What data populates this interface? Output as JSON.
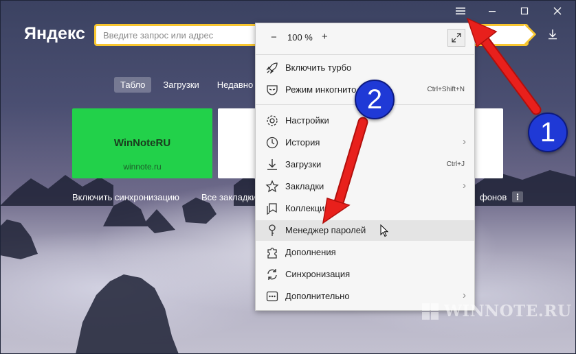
{
  "window": {
    "minimize_icon": "minimize-icon",
    "maximize_icon": "maximize-icon",
    "close_icon": "close-icon"
  },
  "header": {
    "logo": "Яндекс",
    "search_placeholder": "Введите запрос или адрес",
    "search_value": ""
  },
  "tabs": [
    "Табло",
    "Загрузки",
    "Недавно з"
  ],
  "tiles": {
    "tile1_title": "WinNoteRU",
    "tile1_url": "winnote.ru"
  },
  "bottom_links": {
    "sync": "Включить синхронизацию",
    "bookmarks": "Все закладки",
    "backgrounds": "фонов"
  },
  "menu": {
    "zoom_minus": "−",
    "zoom_value": "100 %",
    "zoom_plus": "+",
    "items": [
      {
        "label": "Включить турбо",
        "shortcut": "",
        "arrow": ""
      },
      {
        "label": "Режим инкогнито",
        "shortcut": "Ctrl+Shift+N",
        "arrow": ""
      },
      {
        "label": "Настройки",
        "shortcut": "",
        "arrow": ""
      },
      {
        "label": "История",
        "shortcut": "",
        "arrow": "›"
      },
      {
        "label": "Загрузки",
        "shortcut": "Ctrl+J",
        "arrow": ""
      },
      {
        "label": "Закладки",
        "shortcut": "",
        "arrow": "›"
      },
      {
        "label": "Коллекци",
        "shortcut": "",
        "arrow": ""
      },
      {
        "label": "Менеджер паролей",
        "shortcut": "",
        "arrow": ""
      },
      {
        "label": "Дополнения",
        "shortcut": "",
        "arrow": ""
      },
      {
        "label": "Синхронизация",
        "shortcut": "",
        "arrow": ""
      },
      {
        "label": "Дополнительно",
        "shortcut": "",
        "arrow": "›"
      }
    ]
  },
  "annotations": {
    "badge1": "1",
    "badge2": "2",
    "arrow_color": "#e8201c",
    "badge_color": "#1f39d6"
  },
  "watermark": "WINNOTE.RU"
}
